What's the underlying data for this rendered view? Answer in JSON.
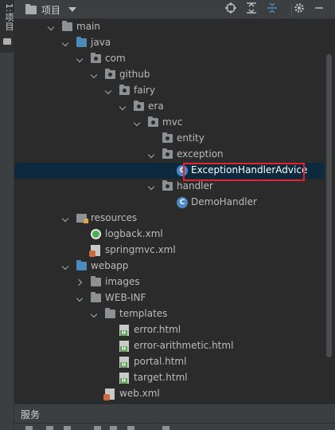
{
  "side_tab": {
    "label": "1:项目"
  },
  "header": {
    "title": "项目",
    "buttons": [
      "target-icon",
      "expand-all-icon",
      "collapse-all-icon",
      "settings-icon",
      "minimize-icon"
    ]
  },
  "tree": [
    {
      "label": "main",
      "depth": 2,
      "expanded": true,
      "icon": "folder"
    },
    {
      "label": "java",
      "depth": 3,
      "expanded": true,
      "icon": "folder-blue"
    },
    {
      "label": "com",
      "depth": 4,
      "expanded": true,
      "icon": "package"
    },
    {
      "label": "github",
      "depth": 5,
      "expanded": true,
      "icon": "package"
    },
    {
      "label": "fairy",
      "depth": 6,
      "expanded": true,
      "icon": "package"
    },
    {
      "label": "era",
      "depth": 7,
      "expanded": true,
      "icon": "package"
    },
    {
      "label": "mvc",
      "depth": 8,
      "expanded": true,
      "icon": "package"
    },
    {
      "label": "entity",
      "depth": 9,
      "expanded": null,
      "icon": "package"
    },
    {
      "label": "exception",
      "depth": 9,
      "expanded": true,
      "icon": "package"
    },
    {
      "label": "ExceptionHandlerAdvice",
      "depth": 10,
      "expanded": null,
      "icon": "class",
      "selected": true,
      "highlighted": true
    },
    {
      "label": "handler",
      "depth": 9,
      "expanded": true,
      "icon": "package"
    },
    {
      "label": "DemoHandler",
      "depth": 10,
      "expanded": null,
      "icon": "class"
    },
    {
      "label": "resources",
      "depth": 3,
      "expanded": true,
      "icon": "resources"
    },
    {
      "label": "logback.xml",
      "depth": 4,
      "expanded": null,
      "icon": "logback"
    },
    {
      "label": "springmvc.xml",
      "depth": 4,
      "expanded": null,
      "icon": "xml"
    },
    {
      "label": "webapp",
      "depth": 3,
      "expanded": true,
      "icon": "web"
    },
    {
      "label": "images",
      "depth": 4,
      "expanded": false,
      "icon": "folder"
    },
    {
      "label": "WEB-INF",
      "depth": 4,
      "expanded": true,
      "icon": "folder"
    },
    {
      "label": "templates",
      "depth": 5,
      "expanded": true,
      "icon": "folder"
    },
    {
      "label": "error.html",
      "depth": 6,
      "expanded": null,
      "icon": "html"
    },
    {
      "label": "error-arithmetic.html",
      "depth": 6,
      "expanded": null,
      "icon": "html"
    },
    {
      "label": "portal.html",
      "depth": 6,
      "expanded": null,
      "icon": "html"
    },
    {
      "label": "target.html",
      "depth": 6,
      "expanded": null,
      "icon": "html"
    },
    {
      "label": "web.xml",
      "depth": 5,
      "expanded": null,
      "icon": "xml"
    }
  ],
  "bottom_panel": {
    "label": "服务"
  }
}
